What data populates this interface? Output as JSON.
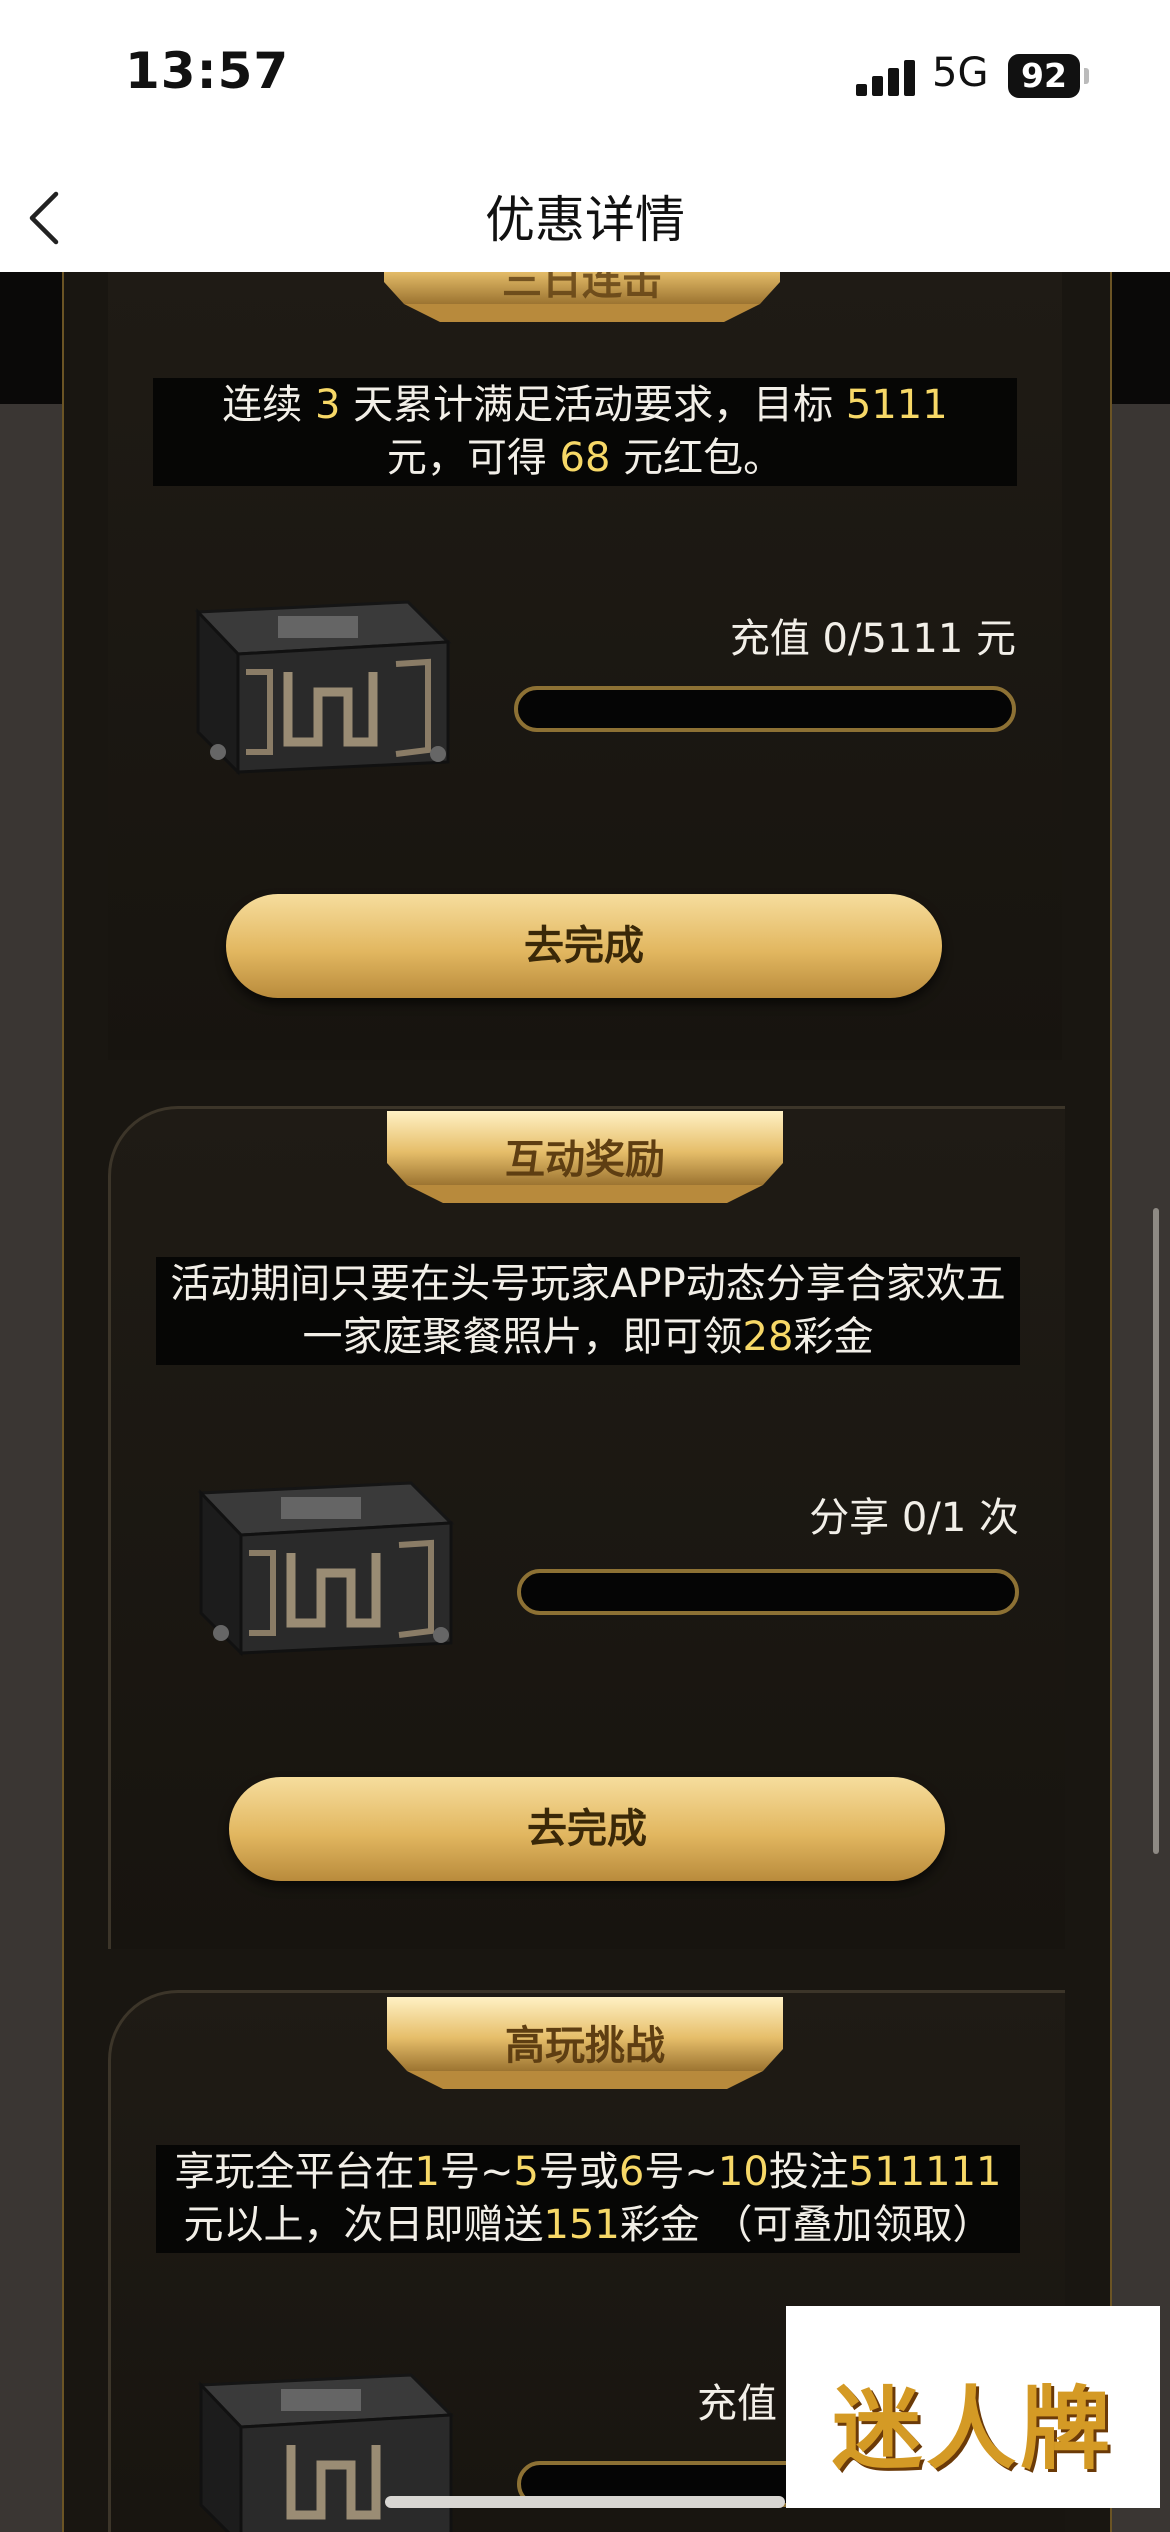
{
  "status_bar": {
    "time": "13:57",
    "network": "5G",
    "battery": "92"
  },
  "nav": {
    "title": "优惠详情"
  },
  "tasks": [
    {
      "title": "三日连击",
      "desc_parts": [
        "连续 ",
        "3",
        " 天累计满足活动要求，目标 ",
        "5111",
        " 元，可得 ",
        "68",
        " 元红包。"
      ],
      "progress_label": "充值 0/5111 元",
      "progress": 0,
      "button": "去完成"
    },
    {
      "title": "互动奖励",
      "desc_parts": [
        "活动期间只要在头号玩家APP动态分享合家欢五一家庭聚餐照片，即可领",
        "28",
        "彩金"
      ],
      "progress_label": "分享 0/1 次",
      "progress": 0,
      "button": "去完成"
    },
    {
      "title": "高玩挑战",
      "desc_parts": [
        "享玩全平台在",
        "1",
        "号~",
        "5",
        "号或",
        "6",
        "号~",
        "10",
        "投注",
        "511111",
        "元以上，次日即赠送",
        "151",
        "彩金 （可叠加领取）"
      ],
      "progress_label": "充值",
      "progress": 0
    }
  ],
  "watermark": "迷人牌",
  "colors": {
    "accent": "#f7d867",
    "gold": "#e2b760",
    "panel": "#191611"
  }
}
